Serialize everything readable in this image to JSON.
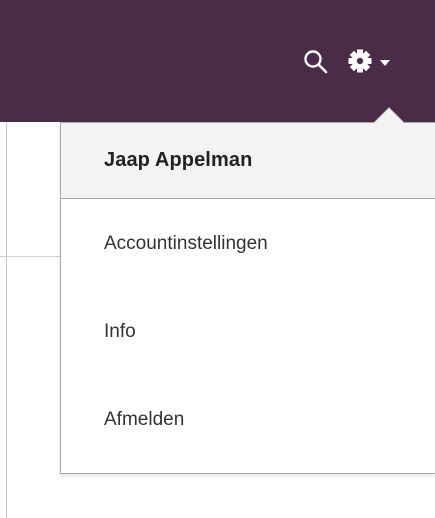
{
  "header": {
    "search_icon": "search-icon",
    "settings_icon": "gear-icon",
    "settings_caret_icon": "caret-down-icon",
    "background_color": "#4a2c49",
    "icon_color": "#ffffff"
  },
  "account_menu": {
    "user_name": "Jaap Appelman",
    "items": [
      {
        "label": "Accountinstellingen"
      },
      {
        "label": "Info"
      },
      {
        "label": "Afmelden"
      }
    ]
  }
}
